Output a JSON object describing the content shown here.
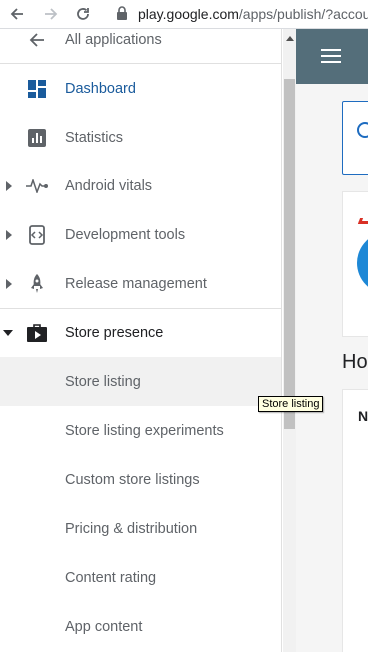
{
  "browser": {
    "url_host": "play.google.com",
    "url_path": "/apps/publish/?accou"
  },
  "sidebar": {
    "back_label": "All applications",
    "items": [
      {
        "label": "Dashboard"
      },
      {
        "label": "Statistics"
      },
      {
        "label": "Android vitals"
      },
      {
        "label": "Development tools"
      },
      {
        "label": "Release management"
      },
      {
        "label": "Store presence"
      }
    ],
    "subitems": [
      {
        "label": "Store listing"
      },
      {
        "label": "Store listing experiments"
      },
      {
        "label": "Custom store listings"
      },
      {
        "label": "Pricing & distribution"
      },
      {
        "label": "Content rating"
      },
      {
        "label": "App content"
      }
    ]
  },
  "tooltip": "Store listing",
  "main": {
    "heading": "Ho",
    "card_letter": "N"
  },
  "colors": {
    "accent": "#1a5b9c",
    "topbar": "#546e7a",
    "selected_bg": "#f1f1f1"
  }
}
